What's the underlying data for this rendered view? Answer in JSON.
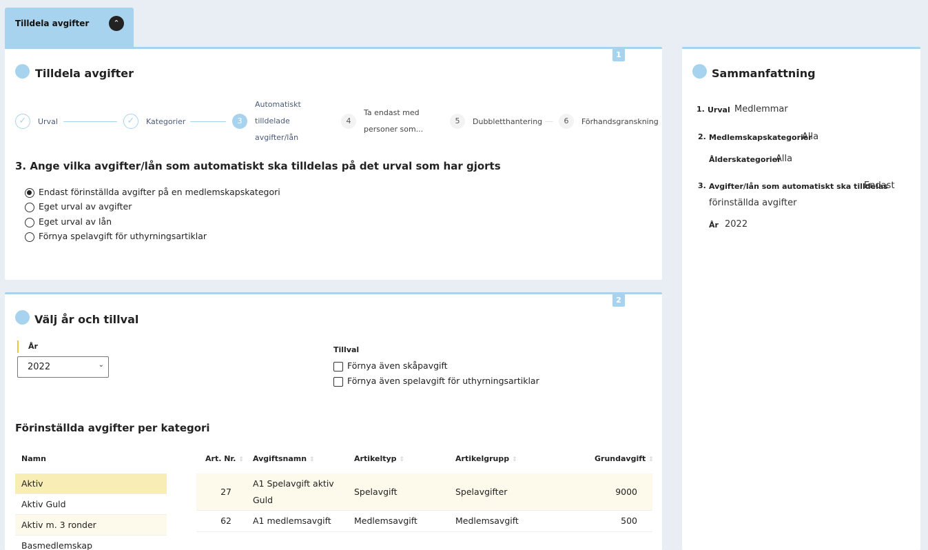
{
  "tab": {
    "label": "Tilldela avgifter"
  },
  "section1": {
    "badge": "1",
    "title": "Tilldela avgifter",
    "steps": [
      {
        "num": "1",
        "label": "Urval",
        "state": "done"
      },
      {
        "num": "2",
        "label": "Kategorier",
        "state": "done"
      },
      {
        "num": "3",
        "label_lines": [
          "Automatiskt",
          "tilldelade",
          "avgifter/lån"
        ],
        "state": "active"
      },
      {
        "num": "4",
        "label_lines": [
          "Ta endast med",
          "personer som..."
        ],
        "state": "pending"
      },
      {
        "num": "5",
        "label": "Dubbletthantering",
        "state": "pending"
      },
      {
        "num": "6",
        "label": "Förhandsgranskning",
        "state": "pending"
      }
    ],
    "question": "3. Ange vilka avgifter/lån som automatiskt ska tilldelas på det urval som har gjorts",
    "options": [
      {
        "label": "Endast förinställda avgifter på en medlemskapskategori",
        "selected": true
      },
      {
        "label": "Eget urval av avgifter",
        "selected": false
      },
      {
        "label": "Eget urval av lån",
        "selected": false
      },
      {
        "label": "Förnya spelavgift för uthyrningsartiklar",
        "selected": false
      }
    ]
  },
  "section2": {
    "badge": "2",
    "title": "Välj år och tillval",
    "year_label": "År",
    "year_value": "2022",
    "extras_label": "Tillval",
    "extras": [
      {
        "label": "Förnya även skåpavgift",
        "checked": false
      },
      {
        "label": "Förnya även spelavgift för uthyrningsartiklar",
        "checked": false
      }
    ],
    "preset_title": "Förinställda avgifter per kategori",
    "category_header": "Namn",
    "categories": [
      {
        "name": "Aktiv",
        "selected": true
      },
      {
        "name": "Aktiv Guld",
        "selected": false
      },
      {
        "name": "Aktiv m. 3 ronder",
        "selected": false
      },
      {
        "name": "Basmedlemskap",
        "selected": false
      }
    ],
    "fee_columns": [
      "Art. Nr.",
      "Avgiftsnamn",
      "Artikeltyp",
      "Artikelgrupp",
      "Grundavgift"
    ],
    "fees": [
      {
        "art_nr": "27",
        "name_lines": [
          "A1 Spelavgift aktiv",
          "Guld"
        ],
        "type": "Spelavgift",
        "group": "Spelavgifter",
        "amount": "9000"
      },
      {
        "art_nr": "62",
        "name": "A1 medlemsavgift",
        "type": "Medlemsavgift",
        "group": "Medlemsavgift",
        "amount": "500"
      }
    ]
  },
  "summary": {
    "title": "Sammanfattning",
    "items": [
      {
        "num": "1.",
        "key": "Urval",
        "value": "Medlemmar"
      },
      {
        "num": "2.",
        "key": "Medlemskapskategorier",
        "value": "Alla"
      },
      {
        "num": "",
        "key": "Ålderskategorier",
        "value": "Alla"
      },
      {
        "num": "3.",
        "key": "Avgifter/lån som automatiskt ska tilldelas",
        "value": "Endast",
        "value_cont": "förinställda avgifter"
      },
      {
        "num": "",
        "key": "År",
        "value": "2022"
      }
    ]
  },
  "colors": {
    "accent": "#a8d3ee",
    "background": "#e9eef5",
    "highlight_row": "#fbf8e6",
    "selected_row": "#f9edb6"
  },
  "icons": {
    "tab_toggle": "chevron-up-icon",
    "step_done": "check-icon",
    "select": "chevron-down-icon"
  }
}
